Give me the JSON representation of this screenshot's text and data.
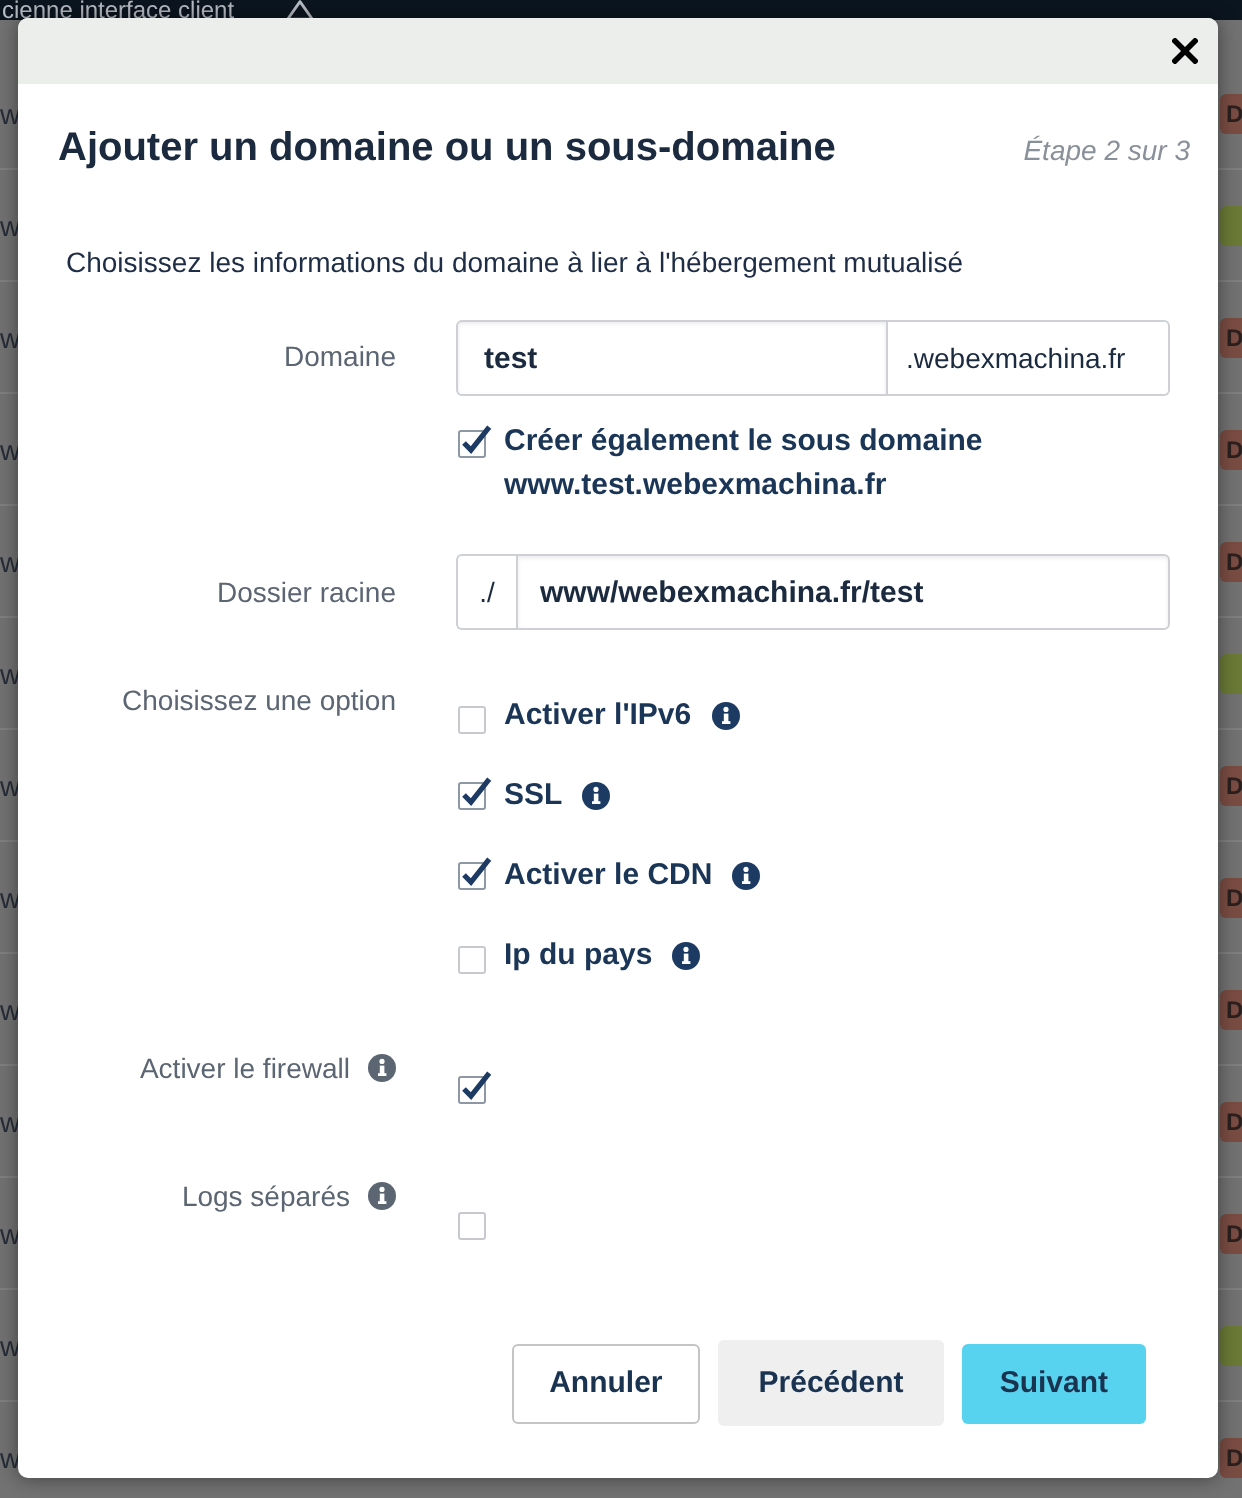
{
  "top_bar": {
    "text": "cienne interface client"
  },
  "background_rows": [
    {
      "text": "w",
      "badge": "D",
      "color": "#7a4d43"
    },
    {
      "text": "w",
      "color": "#6b7a36"
    },
    {
      "text": "w",
      "badge": "D",
      "color": "#7a4d43"
    },
    {
      "text": "w",
      "badge": "D",
      "color": "#7a4d43"
    },
    {
      "text": "w",
      "badge": "D",
      "color": "#7a4d43"
    },
    {
      "text": "w",
      "color": "#6b7a36"
    },
    {
      "text": "w",
      "badge": "D",
      "color": "#7a4d43"
    },
    {
      "text": "w",
      "badge": "D",
      "color": "#7a4d43"
    },
    {
      "text": "w",
      "badge": "D",
      "color": "#7a4d43"
    },
    {
      "text": "w",
      "badge": "D",
      "color": "#7a4d43"
    },
    {
      "text": "w",
      "badge": "D",
      "color": "#7a4d43"
    },
    {
      "text": "w",
      "color": "#6b7a36"
    },
    {
      "text": "w",
      "badge": "D",
      "color": "#7a4d43"
    }
  ],
  "dialog": {
    "title": "Ajouter un domaine ou un sous-domaine",
    "step": "Étape 2 sur 3",
    "intro": "Choisissez les informations du domaine à lier à l'hébergement mutualisé"
  },
  "domain": {
    "label": "Domaine",
    "value": "test",
    "suffix": ".webexmachina.fr",
    "subdomain": {
      "label": "Créer également le sous domaine www.test.webexmachina.fr",
      "checked": true
    }
  },
  "root_folder": {
    "label": "Dossier racine",
    "prefix": "./",
    "value": "www/webexmachina.fr/test"
  },
  "options": {
    "label": "Choisissez une option",
    "items": [
      {
        "label": "Activer l'IPv6",
        "checked": false
      },
      {
        "label": "SSL",
        "checked": true
      },
      {
        "label": "Activer le CDN",
        "checked": true
      },
      {
        "label": "Ip du pays",
        "checked": false
      }
    ]
  },
  "firewall": {
    "label": "Activer le firewall",
    "checked": true
  },
  "separate_logs": {
    "label": "Logs séparés",
    "checked": false
  },
  "buttons": [
    {
      "label": "Annuler",
      "kind": "secondary"
    },
    {
      "label": "Précédent",
      "kind": "default"
    },
    {
      "label": "Suivant",
      "kind": "primary"
    }
  ]
}
